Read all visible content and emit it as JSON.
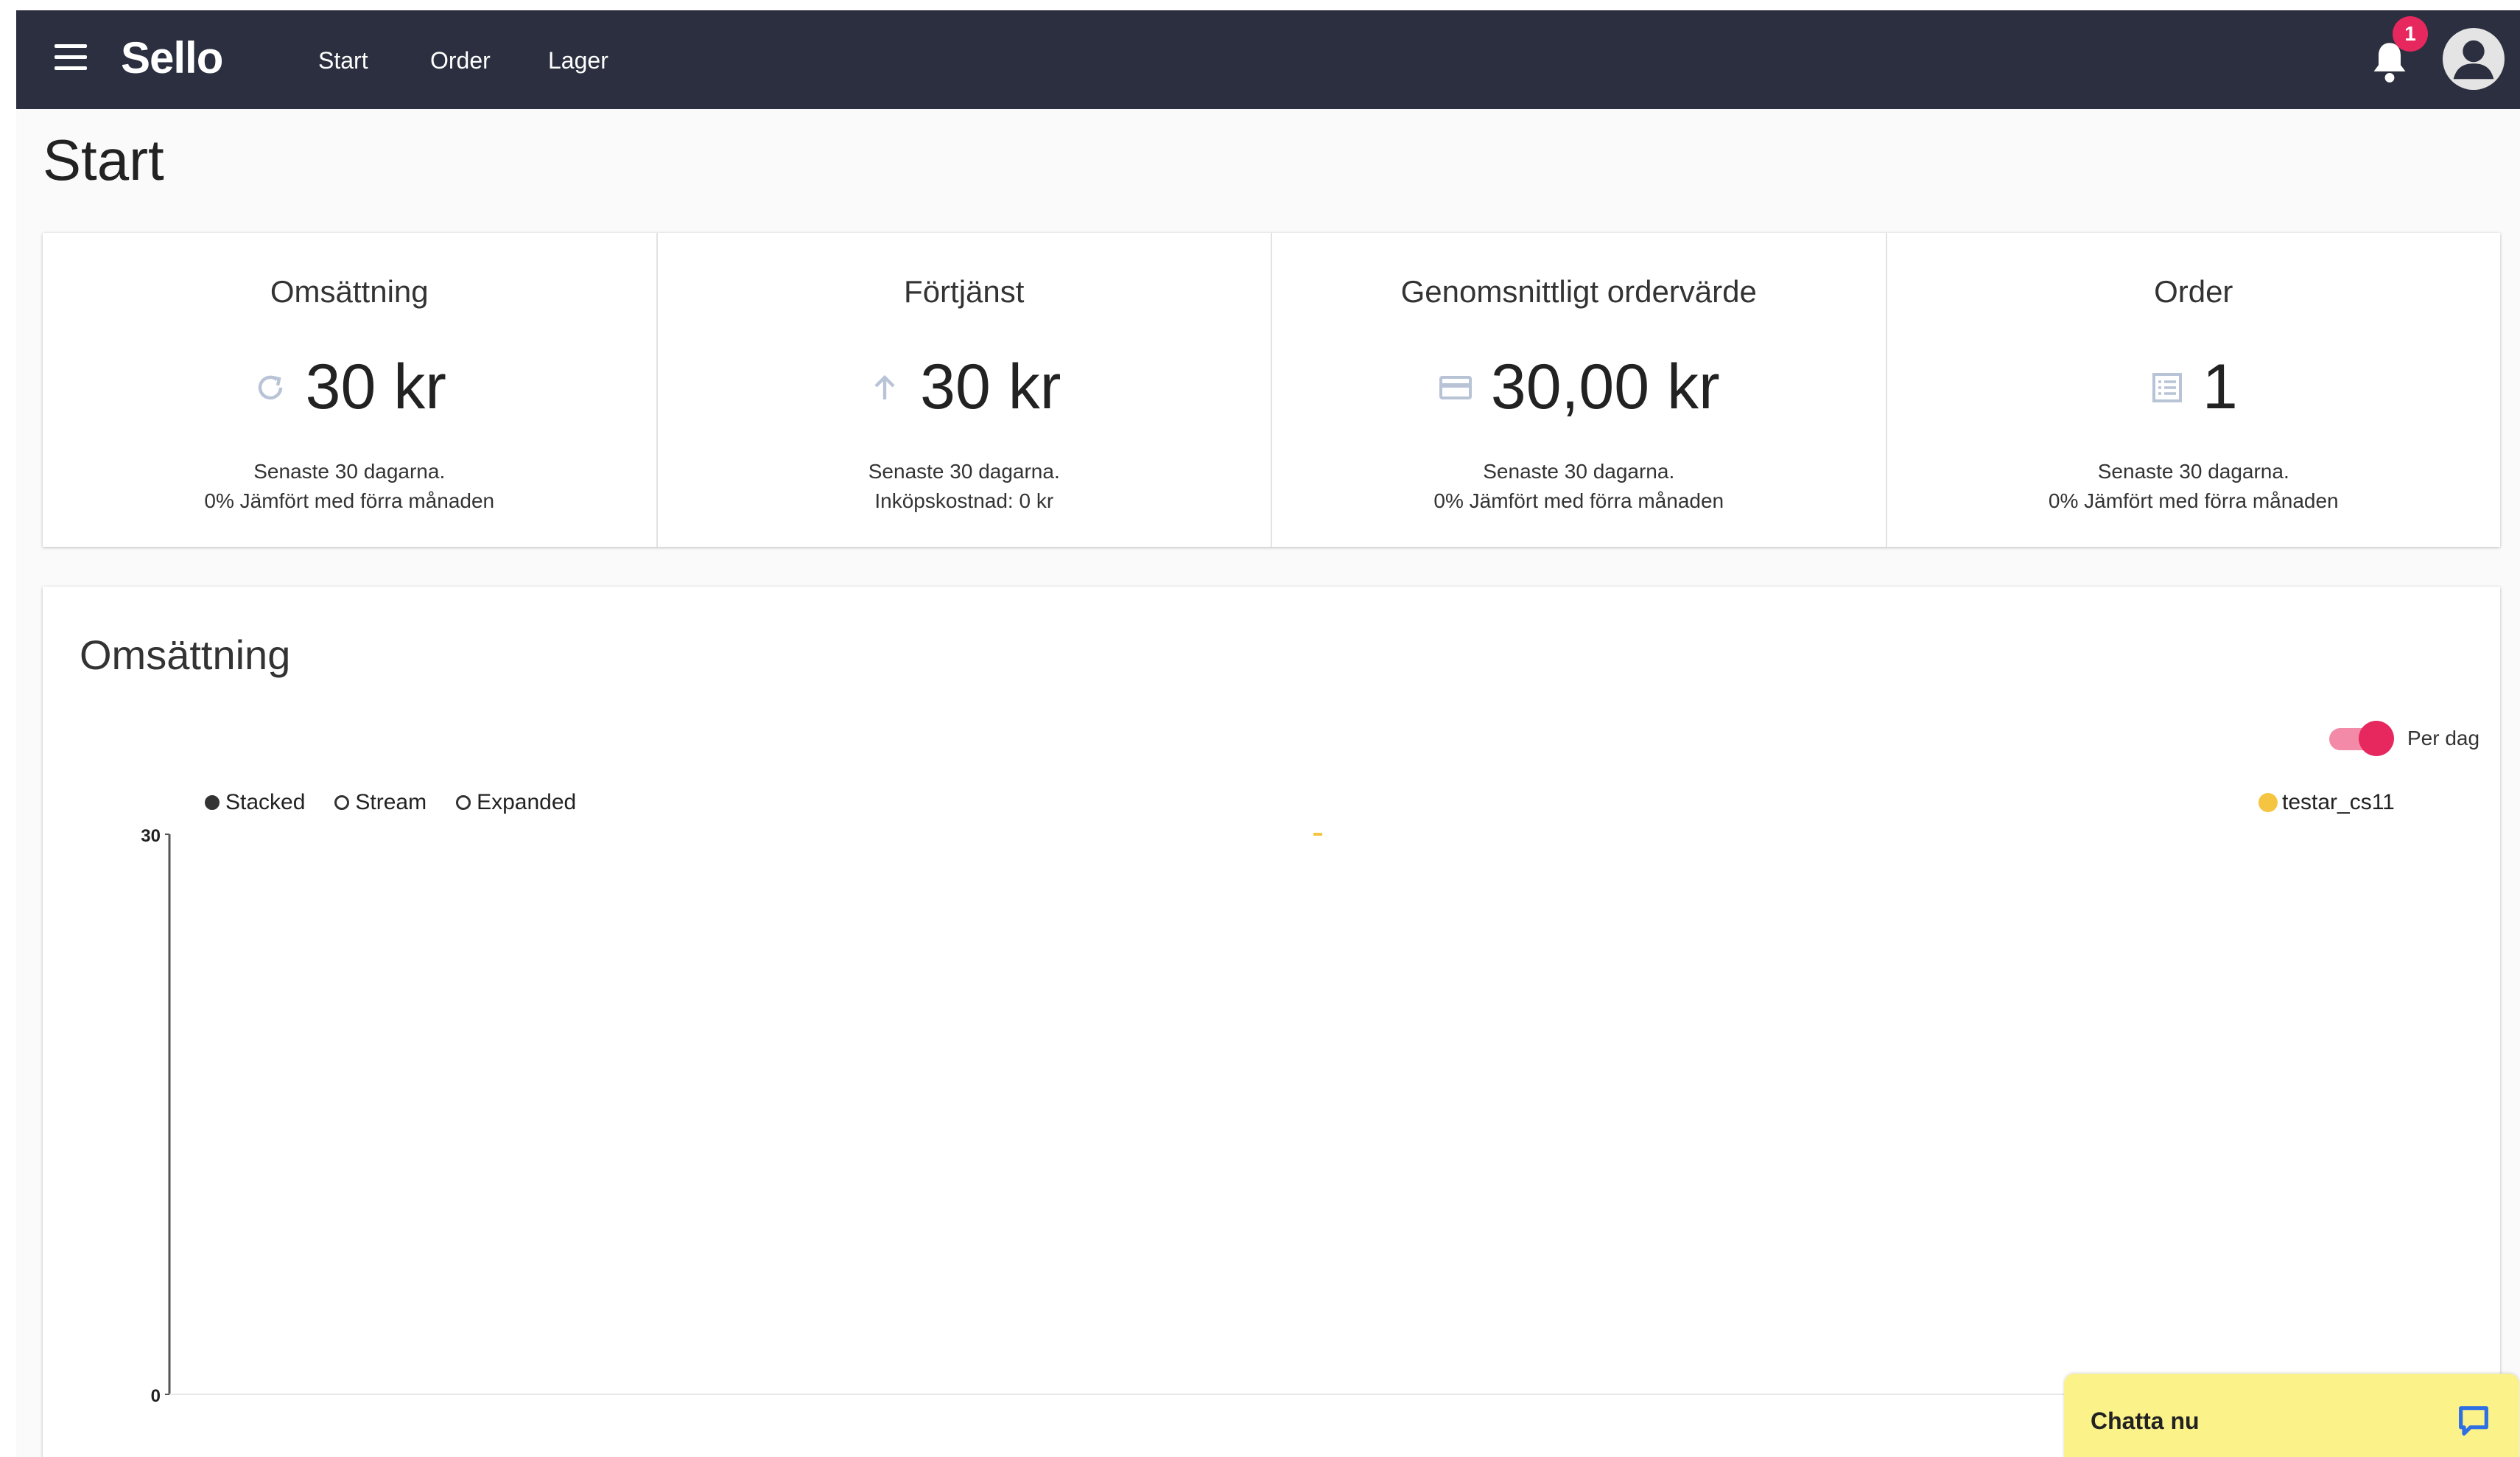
{
  "header": {
    "brand": "Sello",
    "nav": [
      "Start",
      "Order",
      "Lager"
    ],
    "notification_count": "1"
  },
  "page": {
    "title": "Start"
  },
  "stats": [
    {
      "title": "Omsättning",
      "value": "30 kr",
      "icon": "refresh-icon",
      "note1": "Senaste 30 dagarna.",
      "note2": "0% Jämfört med förra månaden"
    },
    {
      "title": "Förtjänst",
      "value": "30 kr",
      "icon": "arrow-up-icon",
      "note1": "Senaste 30 dagarna.",
      "note2": "Inköpskostnad: 0 kr"
    },
    {
      "title": "Genomsnittligt ordervärde",
      "value": "30,00 kr",
      "icon": "credit-card-icon",
      "note1": "Senaste 30 dagarna.",
      "note2": "0% Jämfört med förra månaden"
    },
    {
      "title": "Order",
      "value": "1",
      "icon": "list-icon",
      "note1": "Senaste 30 dagarna.",
      "note2": "0% Jämfört med förra månaden"
    }
  ],
  "chart_panel": {
    "title": "Omsättning",
    "toggle_label": "Per dag",
    "toggle_on": true,
    "modes": [
      "Stacked",
      "Stream",
      "Expanded"
    ],
    "selected_mode": "Stacked"
  },
  "chart_data": {
    "type": "area",
    "series": [
      {
        "name": "testar_cs11",
        "color": "#f5c542",
        "points": [
          {
            "x": 0.5,
            "y": 30
          }
        ]
      }
    ],
    "xlim": [
      0,
      1
    ],
    "ylim": [
      0,
      30
    ],
    "y_ticks": [
      "30",
      "0"
    ],
    "legend_position": "top-right",
    "grid": false
  },
  "chat": {
    "label": "Chatta nu"
  },
  "colors": {
    "topbar": "#2b2f3f",
    "accent": "#e6285f",
    "series": "#f5c542",
    "chat": "#fbf28a"
  }
}
